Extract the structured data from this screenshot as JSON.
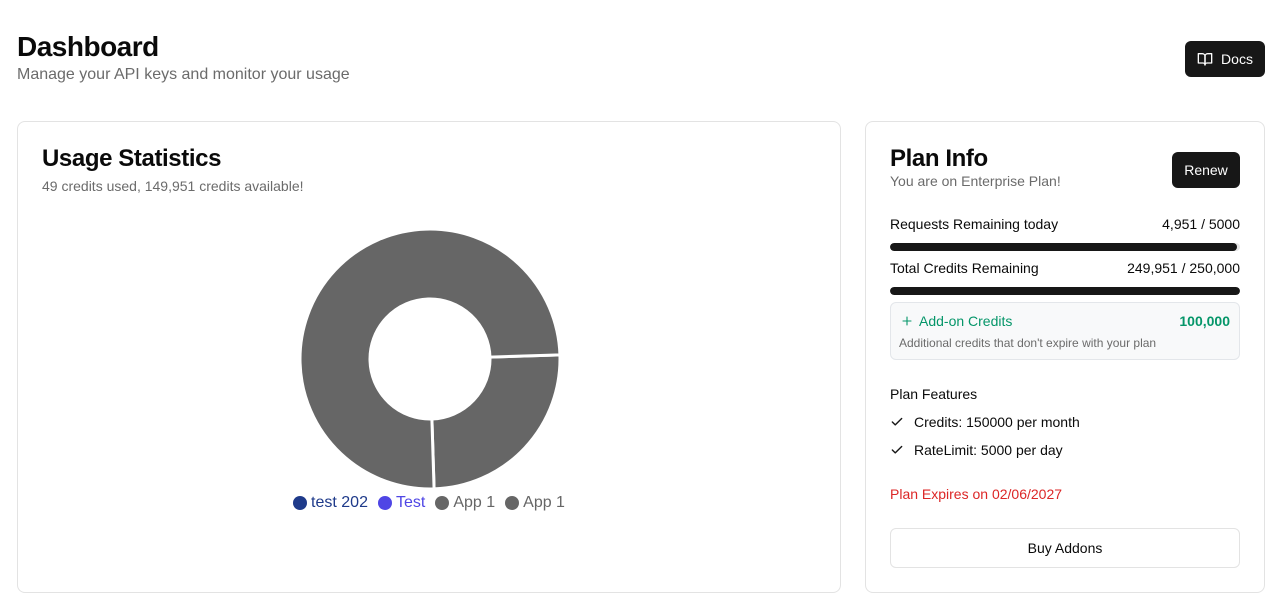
{
  "header": {
    "title": "Dashboard",
    "subtitle": "Manage your API keys and monitor your usage",
    "docs_label": "Docs",
    "docs_icon": "book-open-icon"
  },
  "usage": {
    "title": "Usage Statistics",
    "summary": "49 credits used, 149,951 credits available!",
    "legend": [
      {
        "label": "test 202",
        "color": "#1e3a8a"
      },
      {
        "label": "Test",
        "color": "#4f46e5"
      },
      {
        "label": "App 1",
        "color": "#666666"
      },
      {
        "label": "App 1",
        "color": "#666666"
      }
    ]
  },
  "chart_data": {
    "type": "pie",
    "donut": true,
    "slice_fractions": [
      0.25,
      0.75
    ],
    "slice_color": "#666666"
  },
  "plan": {
    "title": "Plan Info",
    "subtitle": "You are on Enterprise Plan!",
    "renew_label": "Renew",
    "requests": {
      "label": "Requests Remaining today",
      "value": "4,951 / 5000",
      "fraction": 0.9902
    },
    "credits": {
      "label": "Total Credits Remaining",
      "value": "249,951 / 250,000",
      "fraction": 0.9998
    },
    "addon": {
      "title": "Add-on Credits",
      "value": "100,000",
      "description": "Additional credits that don't expire with your plan",
      "icon": "plus-icon"
    },
    "features_title": "Plan Features",
    "features": [
      "Credits: 150000 per month",
      "RateLimit: 5000 per day"
    ],
    "expires": "Plan Expires on 02/06/2027",
    "buy_label": "Buy Addons",
    "colors": {
      "accent": "#171717",
      "addon_green": "#059669",
      "expiry_red": "#dc2626"
    }
  }
}
